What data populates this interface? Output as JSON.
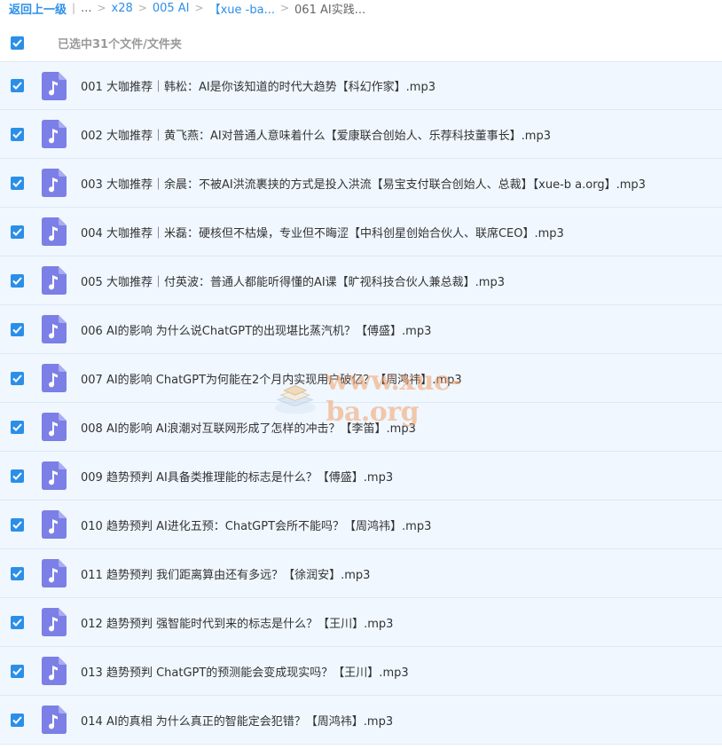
{
  "breadcrumb": {
    "back_label": "返回上一级",
    "ellipsis": "...",
    "items": [
      "x28",
      "005 AI",
      "【xue -ba...",
      "061 AI实践..."
    ],
    "separator": ">",
    "divider": "|"
  },
  "header": {
    "selected_text": "已选中31个文件/文件夹",
    "checkbox_checked": true
  },
  "colors": {
    "accent": "#2b8fe8",
    "file_icon": "#7b7fe6",
    "row_bg": "#f0f7ff",
    "watermark": "#f3a06a"
  },
  "icons": {
    "file": "music-file-icon",
    "checkbox": "checkmark-icon"
  },
  "files": [
    {
      "name": "001 大咖推荐｜韩松：AI是你该知道的时代大趋势【科幻作家】.mp3",
      "checked": true
    },
    {
      "name": "002 大咖推荐｜黄飞燕：AI对普通人意味着什么【爱康联合创始人、乐荐科技董事长】.mp3",
      "checked": true
    },
    {
      "name": "003 大咖推荐｜余晨：不被AI洪流裹挟的方式是投入洪流【易宝支付联合创始人、总裁】【xue-b a.org】.mp3",
      "checked": true
    },
    {
      "name": "004 大咖推荐｜米磊：硬核但不枯燥，专业但不晦涩【中科创星创始合伙人、联席CEO】.mp3",
      "checked": true
    },
    {
      "name": "005 大咖推荐｜付英波：普通人都能听得懂的AI课【旷视科技合伙人兼总裁】.mp3",
      "checked": true
    },
    {
      "name": "006 AI的影响 为什么说ChatGPT的出现堪比蒸汽机？【傅盛】.mp3",
      "checked": true
    },
    {
      "name": "007 AI的影响 ChatGPT为何能在2个月内实现用户破亿？【周鸿祎】.mp3",
      "checked": true
    },
    {
      "name": "008 AI的影响 AI浪潮对互联网形成了怎样的冲击？【李笛】.mp3",
      "checked": true
    },
    {
      "name": "009 趋势预判 AI具备类推理能的标志是什么？【傅盛】.mp3",
      "checked": true
    },
    {
      "name": "010 趋势预判 AI进化五预：ChatGPT会所不能吗？【周鸿祎】.mp3",
      "checked": true
    },
    {
      "name": "011 趋势预判 我们距离算由还有多远？【徐润安】.mp3",
      "checked": true
    },
    {
      "name": "012 趋势预判 强智能时代到来的标志是什么？【王川】.mp3",
      "checked": true
    },
    {
      "name": "013 趋势预判 ChatGPT的预测能会变成现实吗？【王川】.mp3",
      "checked": true
    },
    {
      "name": "014 AI的真相 为什么真正的智能定会犯错？【周鸿祎】.mp3",
      "checked": true
    }
  ],
  "watermark": {
    "text": "www.xue-ba.org"
  }
}
